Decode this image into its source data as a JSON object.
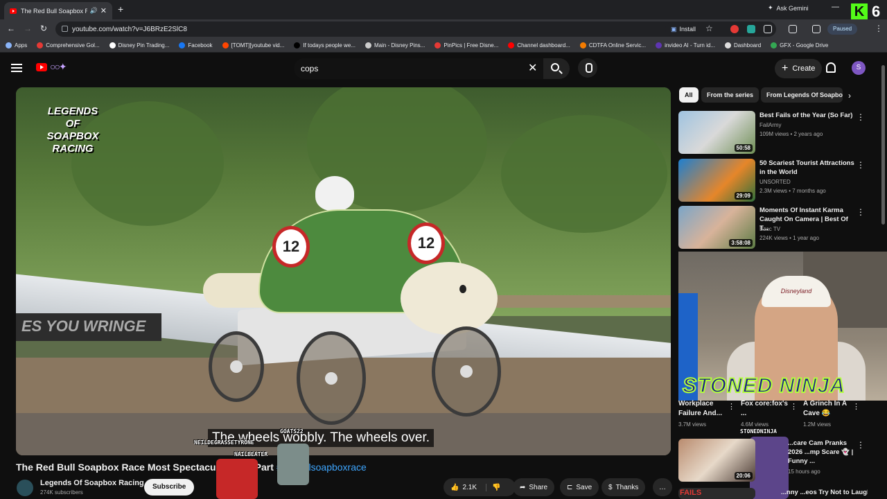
{
  "browser": {
    "tab_title": "The Red Bull Soapbox Race",
    "url": "youtube.com/watch?v=J6BRzE2SlC8",
    "install_label": "Install",
    "paused_label": "Paused",
    "ask_gemini": "Ask Gemini",
    "kick_count": "6",
    "bookmarks": [
      {
        "label": "Apps",
        "color": "#8ab4f8"
      },
      {
        "label": "Comprehensive Gol...",
        "color": "#e53935"
      },
      {
        "label": "Disney Pin Trading...",
        "color": "#ffffff"
      },
      {
        "label": "Facebook",
        "color": "#1877f2"
      },
      {
        "label": "[TOMT][youtube vid...",
        "color": "#ff4500"
      },
      {
        "label": "If todays people we...",
        "color": "#000000"
      },
      {
        "label": "Main - Disney Pins...",
        "color": "#cccccc"
      },
      {
        "label": "PinPics | Free Disne...",
        "color": "#e53935"
      },
      {
        "label": "Channel dashboard...",
        "color": "#ff0000"
      },
      {
        "label": "CDTFA Online Servic...",
        "color": "#f57c00"
      },
      {
        "label": "invideo AI - Turn id...",
        "color": "#5e35b1"
      },
      {
        "label": "Dashboard",
        "color": "#dddddd"
      },
      {
        "label": "GFX - Google Drive",
        "color": "#34a853"
      }
    ]
  },
  "yt": {
    "search_query": "cops",
    "create_label": "Create",
    "avatar_letter": "S"
  },
  "video": {
    "logo_text": "LEGENDS OF SOAPBOX RACING",
    "banner_text": "ES YOU WRINGE",
    "car_number": "12",
    "subtitle": "The wheels wobbly. The wheels over.",
    "title_prefix": "The Red Bull Soapbox Race Most Spectacular Cra",
    "title_mid": " | Part",
    "title_tag": "#redbullsoapboxrace",
    "channel": "Legends Of Soapbox Racing",
    "subscribers": "274K subscribers",
    "subscribe_label": "Subscribe",
    "likes": "2.1K",
    "share_label": "Share",
    "save_label": "Save",
    "thanks_label": "Thanks"
  },
  "overlay_tags": {
    "tag1": "GOATS22",
    "tag2": "NEILDEGRASSETYRONE",
    "tag3": "NAILBEATER",
    "tag4": "STONEDNINJA"
  },
  "chips": [
    "All",
    "From the series",
    "From Legends Of Soapbo"
  ],
  "recs": [
    {
      "title": "Best Fails of the Year (So Far)",
      "channel": "FailArmy",
      "meta": "109M views • 2 years ago",
      "duration": "50:58"
    },
    {
      "title": "50 Scariest Tourist Attractions in the World",
      "channel": "UNSORTED",
      "meta": "2.3M views • 7 months ago",
      "duration": "29:09"
    },
    {
      "title": "Moments Of Instant Karma Caught On Camera | Best Of T...",
      "channel": "Bzac TV",
      "meta": "224K views • 1 year ago",
      "duration": "3:58:08"
    },
    {
      "title": "...care Cam Pranks 2026 ...mp Scare 👻 | Funny ...",
      "channel": "",
      "meta": "15 hours ago",
      "duration": "20:06"
    },
    {
      "title": "...nny ...eos Try Not to Laugh |",
      "channel": "",
      "meta": "",
      "duration": ""
    }
  ],
  "shorts": [
    {
      "title": "Workplace Failure And...",
      "views": "3.7M views"
    },
    {
      "title": "Fox core:fox's ...",
      "views": "4.6M views"
    },
    {
      "title": "A Grinch In A Cave 😂",
      "views": "1.2M views"
    }
  ],
  "webcam": {
    "cap_text": "Disneyland",
    "streamer_name": "STONED NINJA"
  },
  "fails_label": "FAILS"
}
